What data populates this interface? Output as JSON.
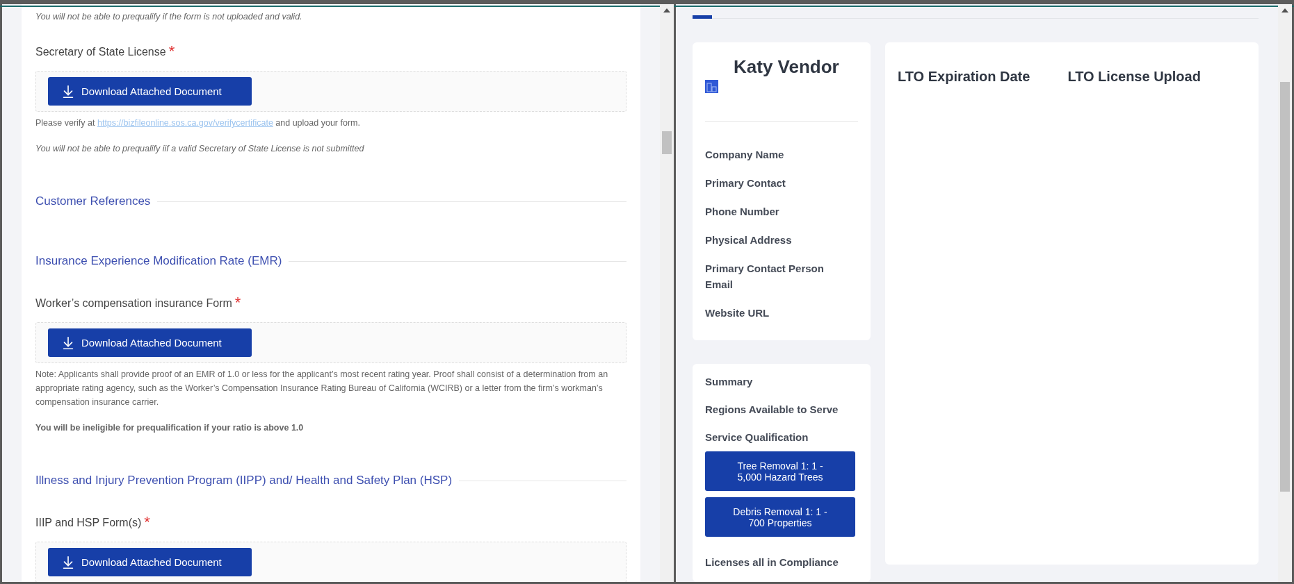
{
  "form_pane": {
    "blocks": [
      {
        "kind": "italic_note",
        "text": "You will not be able to prequalify if the form is not uploaded and valid."
      },
      {
        "kind": "upload",
        "label": "Secretary of State License",
        "required_mark": "*",
        "button": "Download Attached Document",
        "notes": [
          {
            "kind": "link",
            "before": "Please verify at",
            "link": "https://bizfileonline.sos.ca.gov/verifycertificate",
            "after": "and upload your form."
          },
          {
            "kind": "italic",
            "text": "You will not be able to prequalify iif a valid Secretary of State License is not submitted"
          }
        ]
      },
      {
        "kind": "section",
        "title": "Customer References"
      },
      {
        "kind": "section",
        "title": "Insurance Experience Modification Rate (EMR)"
      },
      {
        "kind": "upload",
        "label": "Worker’s compensation insurance Form",
        "required_mark": "*",
        "button": "Download Attached Document",
        "notes": [
          {
            "kind": "plain",
            "text": "Note: Applicants shall provide proof of an EMR of 1.0 or less for the applicant’s most recent rating year. Proof shall consist of a determination from an appropriate rating agency, such as the Worker’s Compensation Insurance Rating Bureau of California (WCIRB) or a letter from the firm’s workman’s compensation insurance carrier."
          },
          {
            "kind": "bold",
            "text": "You will be ineligible for prequalification if your ratio is above 1.0"
          }
        ]
      },
      {
        "kind": "section",
        "title": "Illness and Injury Prevention Program (IIPP) and/ Health and Safety Plan (HSP)"
      },
      {
        "kind": "upload",
        "label": "IIIP and HSP Form(s)",
        "required_mark": "*",
        "button": "Download Attached Document"
      }
    ]
  },
  "profile_pane": {
    "vendor_name": "Katy Vendor",
    "fields": [
      "Company Name",
      "Primary Contact",
      "Phone Number",
      "Physical Address",
      "Primary Contact Person Email",
      "Website URL"
    ],
    "summary_items": [
      {
        "kind": "label",
        "text": "Summary"
      },
      {
        "kind": "label",
        "text": "Regions Available to Serve"
      },
      {
        "kind": "label",
        "text": "Service Qualification"
      },
      {
        "kind": "tag",
        "text": "Tree Removal 1: 1 - 5,000 Hazard Trees"
      },
      {
        "kind": "tag",
        "text": "Debris Removal 1: 1 - 700 Properties"
      },
      {
        "kind": "label",
        "text": "Licenses all in Compliance"
      }
    ],
    "license_columns": [
      "LTO Expiration Date",
      "LTO License Upload"
    ]
  }
}
